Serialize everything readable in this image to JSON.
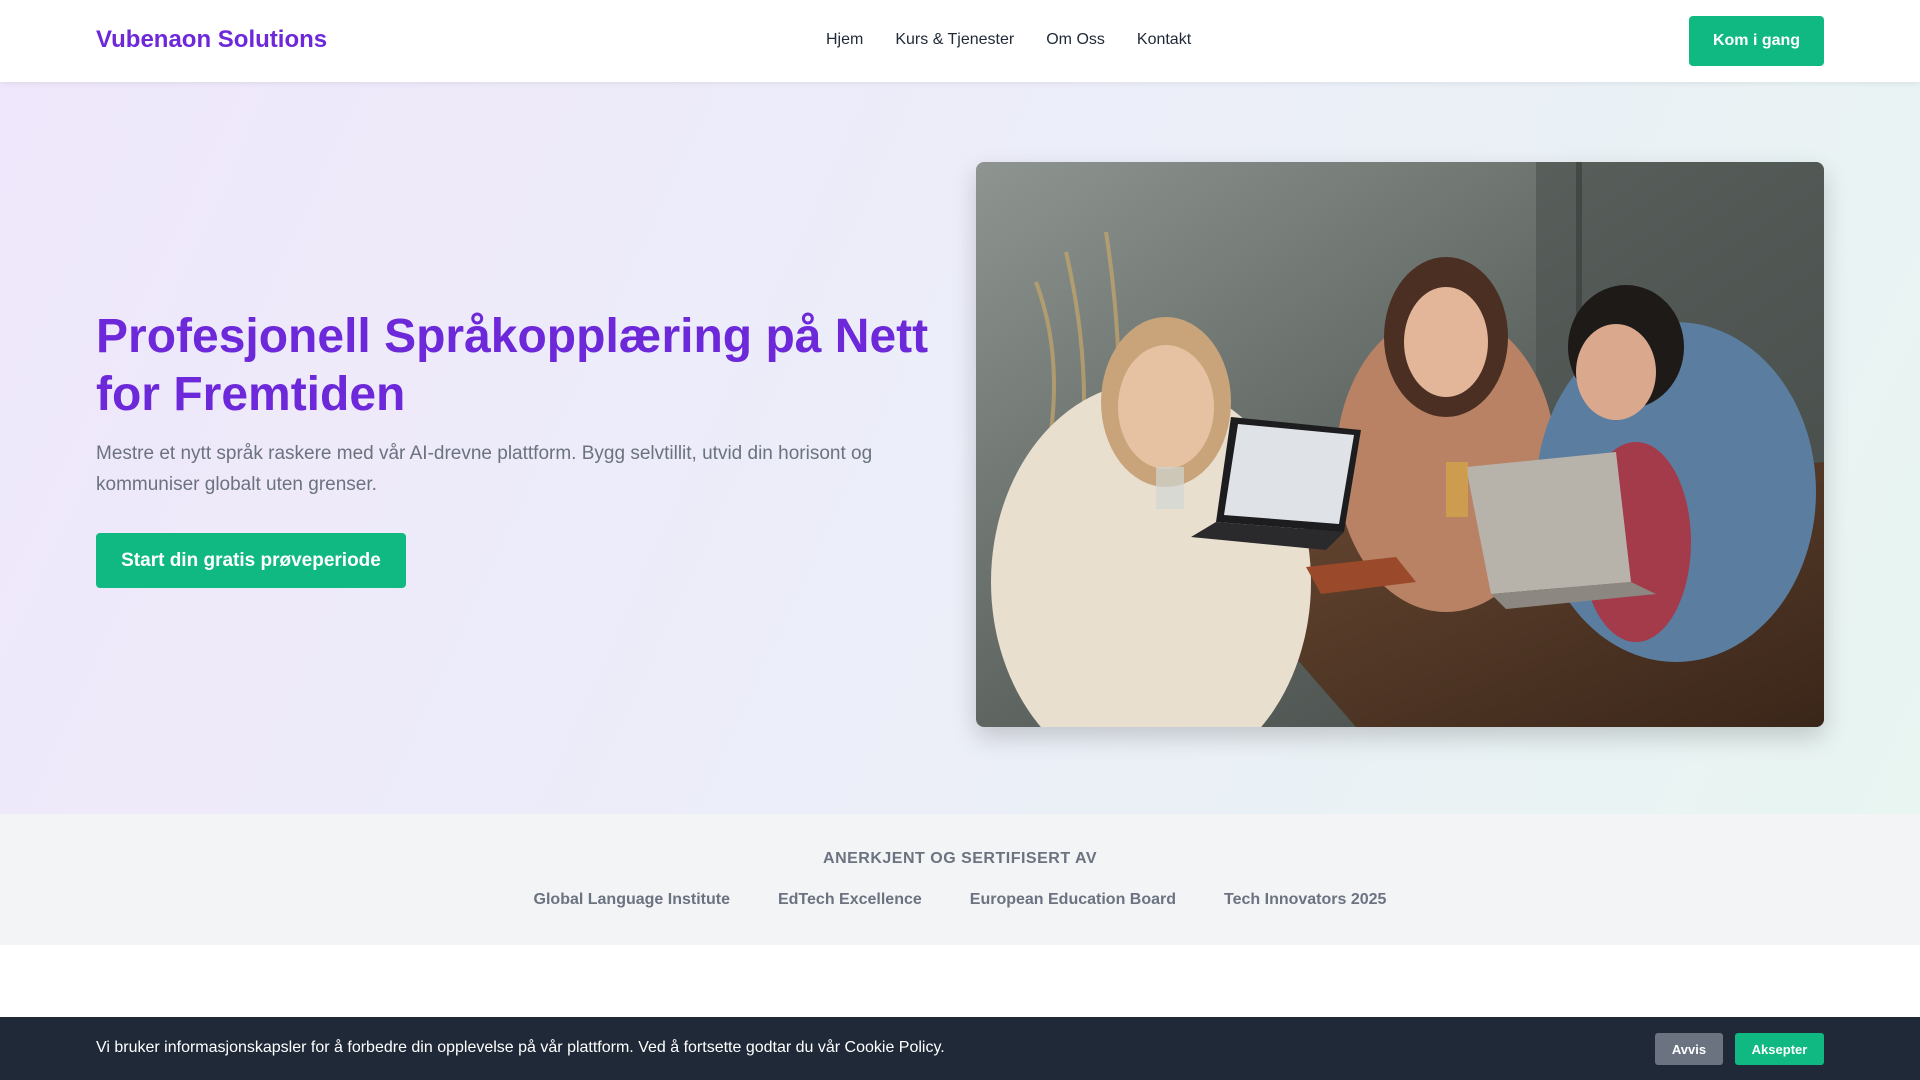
{
  "header": {
    "brand": "Vubenaon Solutions",
    "nav": [
      "Hjem",
      "Kurs & Tjenester",
      "Om Oss",
      "Kontakt"
    ],
    "cta_label": "Kom i gang"
  },
  "hero": {
    "title": "Profesjonell Språkopplæring på Nett for Fremtiden",
    "subtitle": "Mestre et nytt språk raskere med vår AI-drevne plattform. Bygg selvtillit, utvid din horisont og kommuniser globalt uten grenser.",
    "cta_label": "Start din gratis prøveperiode"
  },
  "recognition": {
    "title": "ANERKJENT OG SERTIFISERT AV",
    "partners": [
      "Global Language Institute",
      "EdTech Excellence",
      "European Education Board",
      "Tech Innovators 2025"
    ]
  },
  "cookie": {
    "text": "Vi bruker informasjonskapsler for å forbedre din opplevelse på vår plattform. Ved å fortsette godtar du vår Cookie Policy.",
    "reject_label": "Avvis",
    "accept_label": "Aksepter"
  },
  "colors": {
    "brand": "#6d28d9",
    "accent": "#10b981",
    "cookie_bg": "#1f2937"
  }
}
